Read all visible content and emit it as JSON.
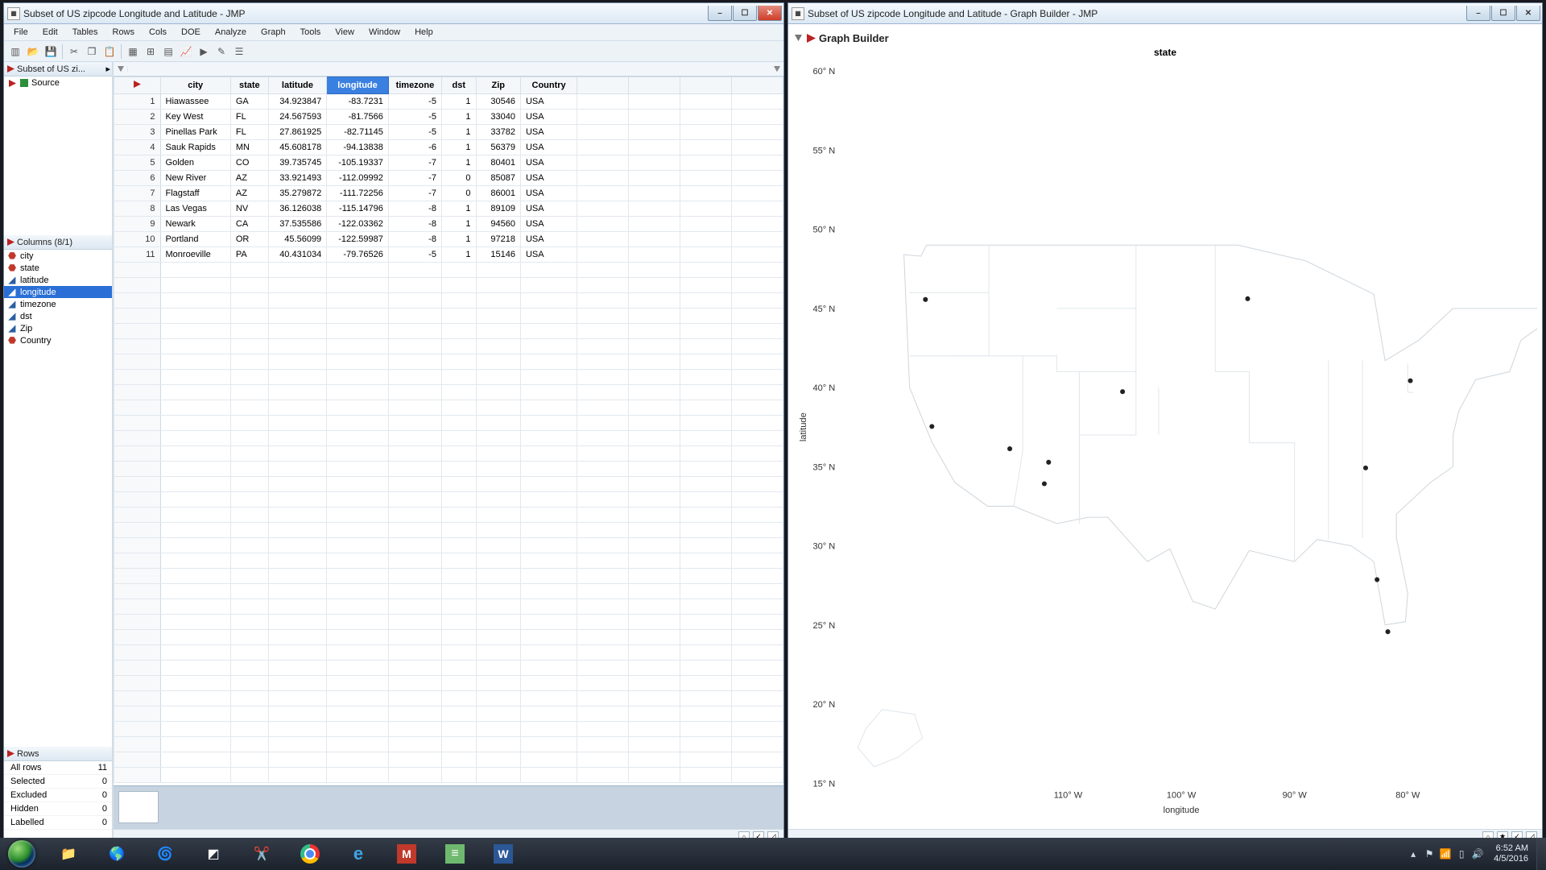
{
  "left_window": {
    "title": "Subset of US zipcode Longitude and Latitude - JMP"
  },
  "right_window": {
    "title": "Subset of US zipcode Longitude and Latitude - Graph Builder - JMP"
  },
  "menu": {
    "file": "File",
    "edit": "Edit",
    "tables": "Tables",
    "rows": "Rows",
    "cols": "Cols",
    "doe": "DOE",
    "analyze": "Analyze",
    "graph": "Graph",
    "tools": "Tools",
    "view": "View",
    "window": "Window",
    "help": "Help"
  },
  "source_panel": {
    "header": "Subset of US zi...",
    "items": [
      "Source"
    ]
  },
  "columns_panel": {
    "header": "Columns (8/1)",
    "items": [
      {
        "icon": "red",
        "name": "city"
      },
      {
        "icon": "red",
        "name": "state"
      },
      {
        "icon": "blue",
        "name": "latitude"
      },
      {
        "icon": "blue",
        "name": "longitude",
        "selected": true
      },
      {
        "icon": "blue",
        "name": "timezone"
      },
      {
        "icon": "blue",
        "name": "dst"
      },
      {
        "icon": "blue",
        "name": "Zip"
      },
      {
        "icon": "red",
        "name": "Country"
      }
    ]
  },
  "rows_panel": {
    "header": "Rows",
    "rows": [
      {
        "label": "All rows",
        "value": "11"
      },
      {
        "label": "Selected",
        "value": "0"
      },
      {
        "label": "Excluded",
        "value": "0"
      },
      {
        "label": "Hidden",
        "value": "0"
      },
      {
        "label": "Labelled",
        "value": "0"
      }
    ]
  },
  "grid": {
    "headers": [
      "city",
      "state",
      "latitude",
      "longitude",
      "timezone",
      "dst",
      "Zip",
      "Country"
    ],
    "selected_col": "longitude",
    "rows": [
      {
        "n": 1,
        "city": "Hiawassee",
        "state": "GA",
        "latitude": "34.923847",
        "longitude": "-83.7231",
        "timezone": "-5",
        "dst": "1",
        "Zip": "30546",
        "Country": "USA"
      },
      {
        "n": 2,
        "city": "Key West",
        "state": "FL",
        "latitude": "24.567593",
        "longitude": "-81.7566",
        "timezone": "-5",
        "dst": "1",
        "Zip": "33040",
        "Country": "USA"
      },
      {
        "n": 3,
        "city": "Pinellas Park",
        "state": "FL",
        "latitude": "27.861925",
        "longitude": "-82.71145",
        "timezone": "-5",
        "dst": "1",
        "Zip": "33782",
        "Country": "USA"
      },
      {
        "n": 4,
        "city": "Sauk Rapids",
        "state": "MN",
        "latitude": "45.608178",
        "longitude": "-94.13838",
        "timezone": "-6",
        "dst": "1",
        "Zip": "56379",
        "Country": "USA"
      },
      {
        "n": 5,
        "city": "Golden",
        "state": "CO",
        "latitude": "39.735745",
        "longitude": "-105.19337",
        "timezone": "-7",
        "dst": "1",
        "Zip": "80401",
        "Country": "USA"
      },
      {
        "n": 6,
        "city": "New River",
        "state": "AZ",
        "latitude": "33.921493",
        "longitude": "-112.09992",
        "timezone": "-7",
        "dst": "0",
        "Zip": "85087",
        "Country": "USA"
      },
      {
        "n": 7,
        "city": "Flagstaff",
        "state": "AZ",
        "latitude": "35.279872",
        "longitude": "-111.72256",
        "timezone": "-7",
        "dst": "0",
        "Zip": "86001",
        "Country": "USA"
      },
      {
        "n": 8,
        "city": "Las Vegas",
        "state": "NV",
        "latitude": "36.126038",
        "longitude": "-115.14796",
        "timezone": "-8",
        "dst": "1",
        "Zip": "89109",
        "Country": "USA"
      },
      {
        "n": 9,
        "city": "Newark",
        "state": "CA",
        "latitude": "37.535586",
        "longitude": "-122.03362",
        "timezone": "-8",
        "dst": "1",
        "Zip": "94560",
        "Country": "USA"
      },
      {
        "n": 10,
        "city": "Portland",
        "state": "OR",
        "latitude": "45.56099",
        "longitude": "-122.59987",
        "timezone": "-8",
        "dst": "1",
        "Zip": "97218",
        "Country": "USA"
      },
      {
        "n": 11,
        "city": "Monroeville",
        "state": "PA",
        "latitude": "40.431034",
        "longitude": "-79.76526",
        "timezone": "-5",
        "dst": "1",
        "Zip": "15146",
        "Country": "USA"
      }
    ]
  },
  "graph_builder": {
    "title": "Graph Builder",
    "subtitle": "state",
    "xlabel": "longitude",
    "ylabel": "latitude"
  },
  "chart_data": {
    "type": "scatter",
    "title": "state",
    "xlabel": "longitude",
    "ylabel": "latitude",
    "xlim": [
      -130,
      -70
    ],
    "ylim": [
      15,
      60
    ],
    "x_ticks": [
      -110,
      -100,
      -90,
      -80
    ],
    "x_tick_labels": [
      "110° W",
      "100° W",
      "90° W",
      "80° W"
    ],
    "y_ticks": [
      15,
      20,
      25,
      30,
      35,
      40,
      45,
      50,
      55,
      60
    ],
    "y_tick_labels": [
      "15° N",
      "20° N",
      "25° N",
      "30° N",
      "35° N",
      "40° N",
      "45° N",
      "50° N",
      "55° N",
      "60° N"
    ],
    "series": [
      {
        "name": "points",
        "x": [
          -83.72,
          -81.76,
          -82.71,
          -94.14,
          -105.19,
          -112.1,
          -111.72,
          -115.15,
          -122.03,
          -122.6,
          -79.77
        ],
        "y": [
          34.92,
          24.57,
          27.86,
          45.61,
          39.74,
          33.92,
          35.28,
          36.13,
          37.54,
          45.56,
          40.43
        ]
      }
    ],
    "map_background": "US states outline"
  },
  "system": {
    "time": "6:52 AM",
    "date": "4/5/2016"
  }
}
